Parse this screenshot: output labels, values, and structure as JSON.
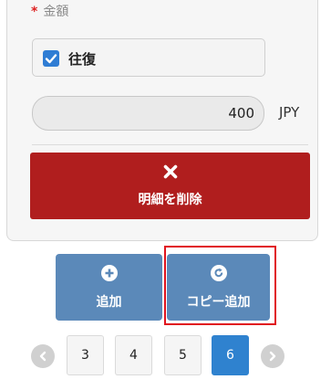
{
  "form": {
    "required_mark": "*",
    "amount_label": "金額",
    "round_trip_label": "往復",
    "round_trip_checked": true,
    "amount_value": "400",
    "currency": "JPY",
    "delete_label": "明細を削除"
  },
  "actions": {
    "add_label": "追加",
    "copy_add_label": "コピー追加"
  },
  "pagination": {
    "pages": [
      "3",
      "4",
      "5",
      "6"
    ],
    "current": "6"
  },
  "colors": {
    "delete": "#b01e1e",
    "action": "#5b89b9",
    "active_page": "#2f82cf",
    "checkbox": "#2f7dd4",
    "highlight": "#e0141e"
  },
  "icons": {
    "delete": "close-icon",
    "add": "plus-icon",
    "copy_add": "redo-icon",
    "prev": "chevron-left-icon",
    "next": "chevron-right-icon",
    "check": "checkmark-icon"
  }
}
